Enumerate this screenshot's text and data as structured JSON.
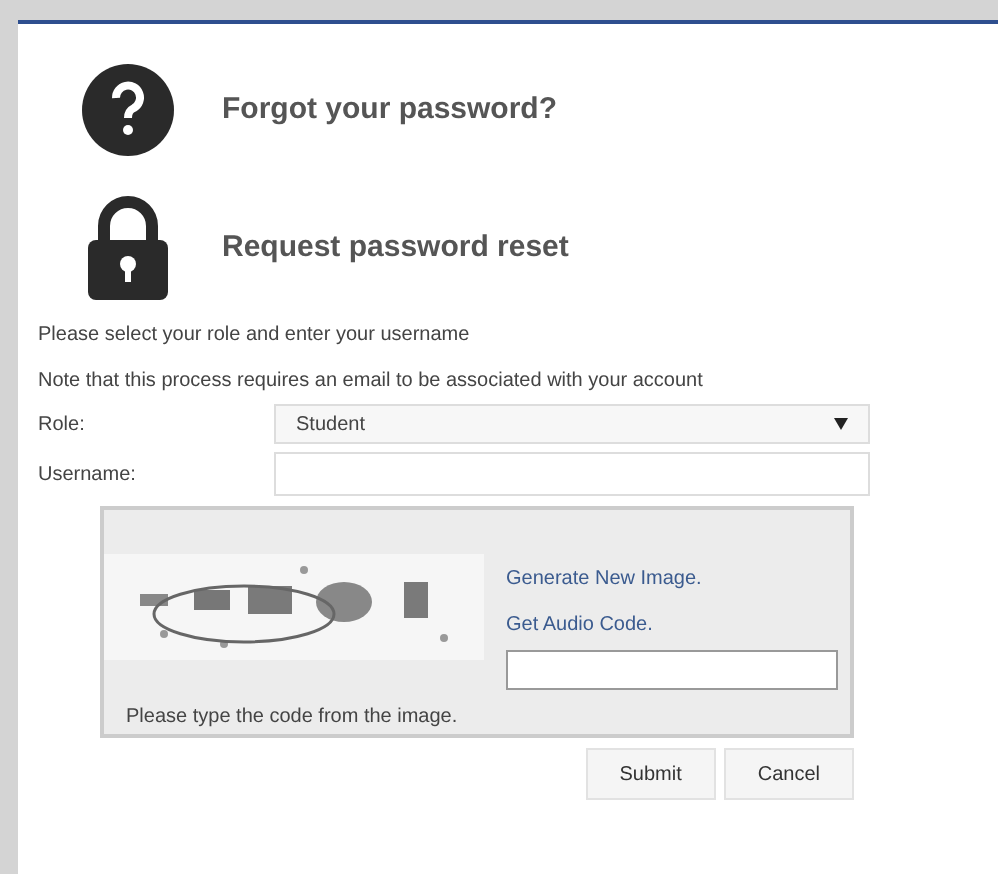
{
  "headings": [
    {
      "kind": "question",
      "text": "Forgot your password?"
    },
    {
      "kind": "lock",
      "text": "Request password reset"
    }
  ],
  "instructions": [
    "Please select your role and enter your username",
    "Note that this process requires an email to be associated with your account"
  ],
  "role": {
    "label": "Role:",
    "value": "Student"
  },
  "username": {
    "label": "Username:"
  },
  "captcha": {
    "links": [
      "Generate New Image.",
      "Get Audio Code."
    ],
    "hint": "Please type the code from the image."
  },
  "buttons": [
    "Submit",
    "Cancel"
  ]
}
